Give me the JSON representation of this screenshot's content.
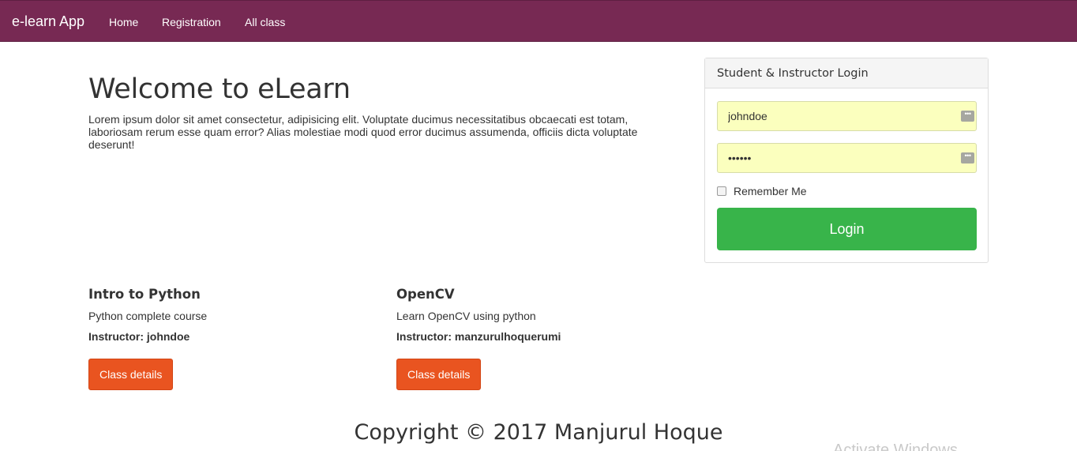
{
  "navbar": {
    "brand": "e-learn App",
    "links": [
      "Home",
      "Registration",
      "All class"
    ]
  },
  "hero": {
    "title": "Welcome to eLearn",
    "text": "Lorem ipsum dolor sit amet consectetur, adipisicing elit. Voluptate ducimus necessitatibus obcaecati est totam, laboriosam rerum esse quam error? Alias molestiae modi quod error ducimus assumenda, officiis dicta voluptate deserunt!"
  },
  "courses": [
    {
      "title": "Intro to Python",
      "description": "Python complete course",
      "instructor": "Instructor: johndoe",
      "button": "Class details"
    },
    {
      "title": "OpenCV",
      "description": "Learn OpenCV using python",
      "instructor": "Instructor: manzurulhoquerumi",
      "button": "Class details"
    }
  ],
  "login": {
    "heading": "Student & Instructor Login",
    "username_value": "johndoe",
    "password_value": "secret",
    "field_icon": "password-manager-icon",
    "remember_label": "Remember Me",
    "button": "Login"
  },
  "footer": {
    "copyright": "Copyright © 2017 Manjurul Hoque"
  },
  "overlay": {
    "watermark": "Activate Windows"
  },
  "colors": {
    "navbar": "#772953",
    "accent_button": "#e95420",
    "login_button": "#38b44a",
    "autofill_field": "#fbffbe"
  }
}
